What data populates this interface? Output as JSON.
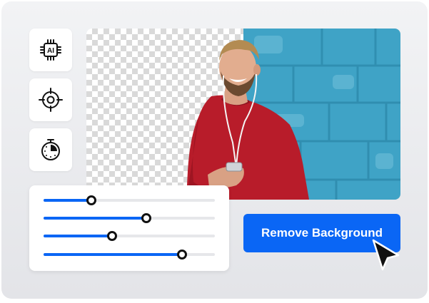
{
  "tools": [
    {
      "icon": "ai-chip-icon",
      "label": "AI"
    },
    {
      "icon": "target-icon"
    },
    {
      "icon": "stopwatch-icon"
    }
  ],
  "preview": {
    "subject": "smiling man with headphones and phone",
    "background_removed_side": "left",
    "background_color": "#3fa3c6"
  },
  "sliders": [
    {
      "value": 0.28
    },
    {
      "value": 0.6
    },
    {
      "value": 0.4
    },
    {
      "value": 0.81
    }
  ],
  "action": {
    "label": "Remove Background"
  },
  "colors": {
    "accent": "#0a66f5"
  }
}
